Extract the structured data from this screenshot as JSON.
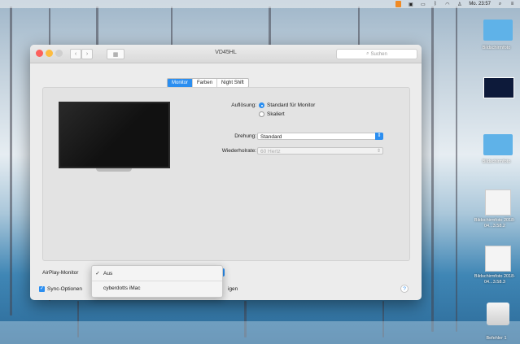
{
  "menubar": {
    "clock": "Mo. 23:57",
    "icons": [
      "app-icon",
      "screen-icon",
      "display-icon",
      "bluetooth-icon",
      "wifi-icon",
      "user-icon",
      "search-icon",
      "list-icon"
    ]
  },
  "window": {
    "title": "VD45HL",
    "search_placeholder": "Suchen",
    "tabs": [
      "Monitor",
      "Farben",
      "Night Shift"
    ],
    "resolution_label": "Auflösung:",
    "resolution_options": [
      "Standard für Monitor",
      "Skaliert"
    ],
    "rotation_label": "Drehung:",
    "rotation_value": "Standard",
    "refresh_label": "Wiederholrate:",
    "refresh_value": "60 Hertz",
    "airplay_label": "AirPlay-Monitor",
    "sync_label": "Sync-Optionen",
    "sync_suffix": "igen",
    "help": "?"
  },
  "dropdown": {
    "items": [
      {
        "label": "Aus",
        "checked": true,
        "check": "✓"
      },
      {
        "label": "cyberdotts iMac",
        "checked": false,
        "check": ""
      }
    ]
  },
  "desktop": {
    "items": [
      {
        "label": "Bildschirmfoto",
        "icon": "folder-icon"
      },
      {
        "label": "",
        "icon": "display-thumbnail-icon"
      },
      {
        "label": "Bildschirmfoto",
        "icon": "folder-icon"
      },
      {
        "label": "Bildschirmfoto 2018-04...3.58.2",
        "icon": "screenshot-icon"
      },
      {
        "label": "Bildschirmfoto 2018-04...3.58.3",
        "icon": "screenshot-icon"
      },
      {
        "label": "Befehler 1",
        "icon": "drive-icon"
      }
    ]
  },
  "colors": {
    "accent": "#2b8ef0",
    "window_bg": "#ececec"
  }
}
